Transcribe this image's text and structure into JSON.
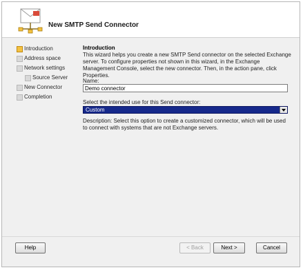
{
  "window": {
    "title": "New SMTP Send Connector"
  },
  "nav": {
    "items": [
      {
        "label": "Introduction",
        "active": true
      },
      {
        "label": "Address space",
        "active": false
      },
      {
        "label": "Network settings",
        "active": false
      },
      {
        "label": "Source Server",
        "active": false
      },
      {
        "label": "New Connector",
        "active": false
      },
      {
        "label": "Completion",
        "active": false
      }
    ]
  },
  "content": {
    "section_title": "Introduction",
    "intro_text": "This wizard helps you create a new SMTP Send connector on the selected Exchange server. To configure properties not shown in this wizard, in the Exchange Management Console, select the new connector. Then, in the action pane, click Properties.",
    "name_label": "Name:",
    "name_value": "Demo connector",
    "use_label": "Select the intended use for this Send connector:",
    "use_selected": "Custom",
    "description": "Description: Select this option to create a customized connector, which will be used to connect with systems that are not Exchange servers."
  },
  "buttons": {
    "help": "Help",
    "back": "< Back",
    "next": "Next >",
    "cancel": "Cancel"
  },
  "colors": {
    "active_step": "#f4c241",
    "select_highlight": "#16298b"
  },
  "icons": {
    "header": "connector-envelope-icon",
    "step": "step-square-icon"
  }
}
